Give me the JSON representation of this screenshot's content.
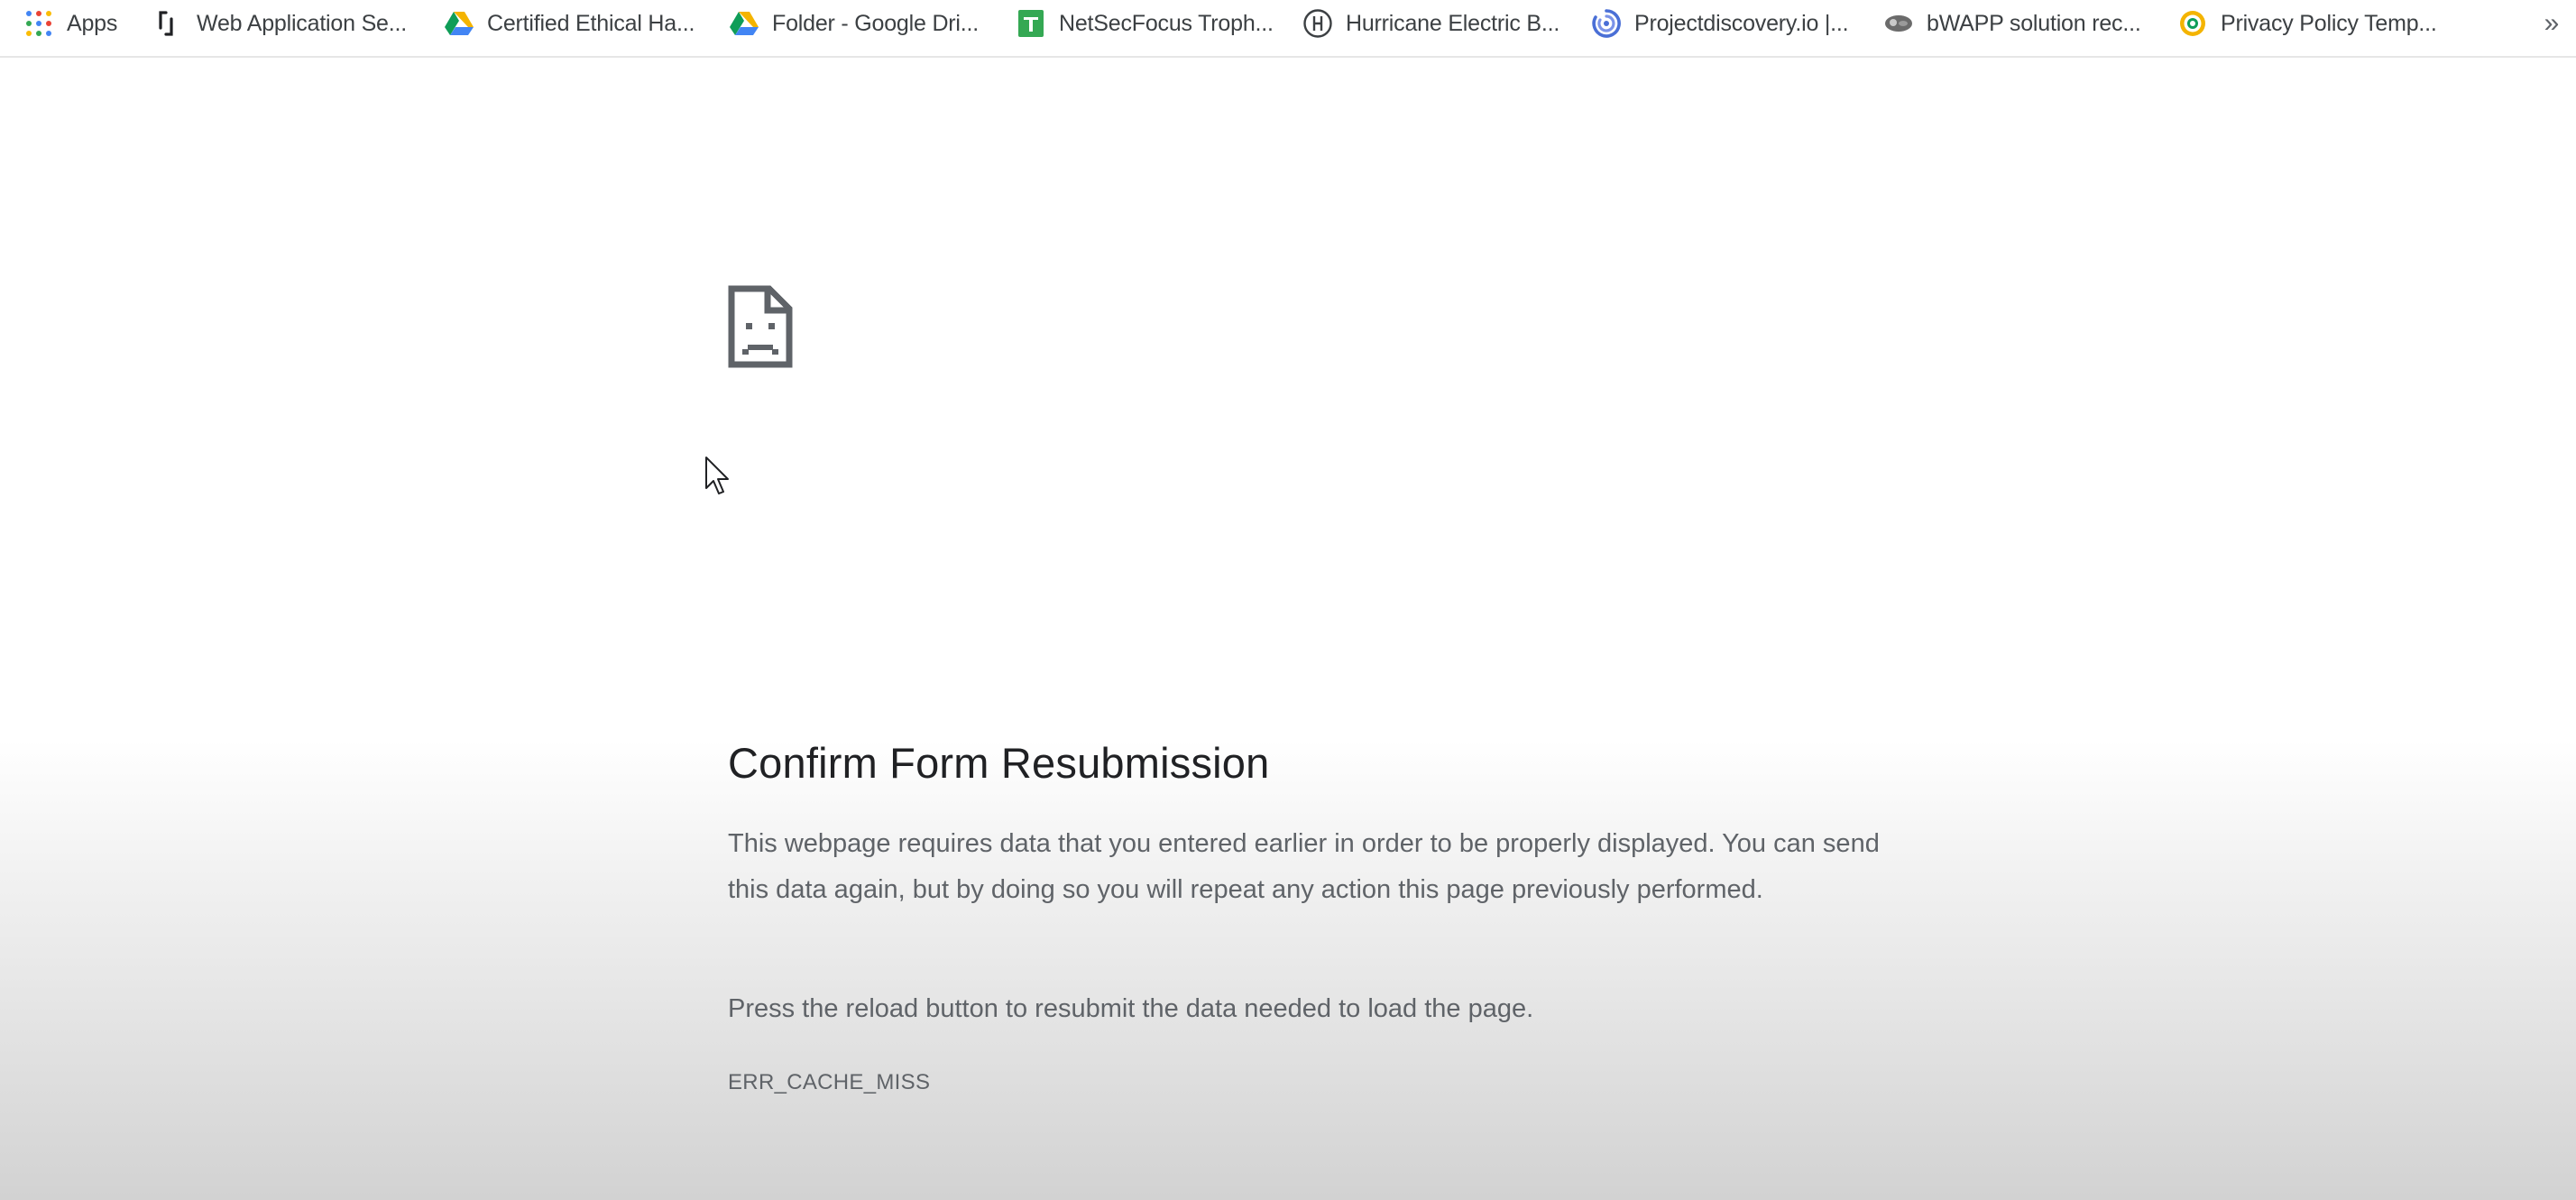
{
  "bookmarks_bar": {
    "items": [
      {
        "label": "Apps",
        "icon": "apps-grid-icon"
      },
      {
        "label": "Web Application Se...",
        "icon": "bracket-logo-icon"
      },
      {
        "label": "Certified Ethical Ha...",
        "icon": "google-drive-icon"
      },
      {
        "label": "Folder - Google Dri...",
        "icon": "google-drive-icon"
      },
      {
        "label": "NetSecFocus Troph...",
        "icon": "google-sheets-icon"
      },
      {
        "label": "Hurricane Electric B...",
        "icon": "hurricane-electric-icon"
      },
      {
        "label": "Projectdiscovery.io |...",
        "icon": "projectdiscovery-icon"
      },
      {
        "label": "bWAPP solution rec...",
        "icon": "bwapp-icon"
      },
      {
        "label": "Privacy Policy Temp...",
        "icon": "privacy-policy-icon"
      }
    ],
    "overflow_glyph": "»"
  },
  "error_page": {
    "icon": "sad-document-icon",
    "title": "Confirm Form Resubmission",
    "description": "This webpage requires data that you entered earlier in order to be properly displayed. You can send this data again, but by doing so you will repeat any action this page previously performed.",
    "hint": "Press the reload button to resubmit the data needed to load the page.",
    "error_code": "ERR_CACHE_MISS"
  },
  "colors": {
    "title": "#202124",
    "body_text": "#5f6368",
    "bookmark_text": "#3c4043",
    "drive_green": "#0f9d58",
    "drive_yellow": "#f4b400",
    "drive_blue": "#4285f4",
    "sheets_green": "#34a853"
  }
}
